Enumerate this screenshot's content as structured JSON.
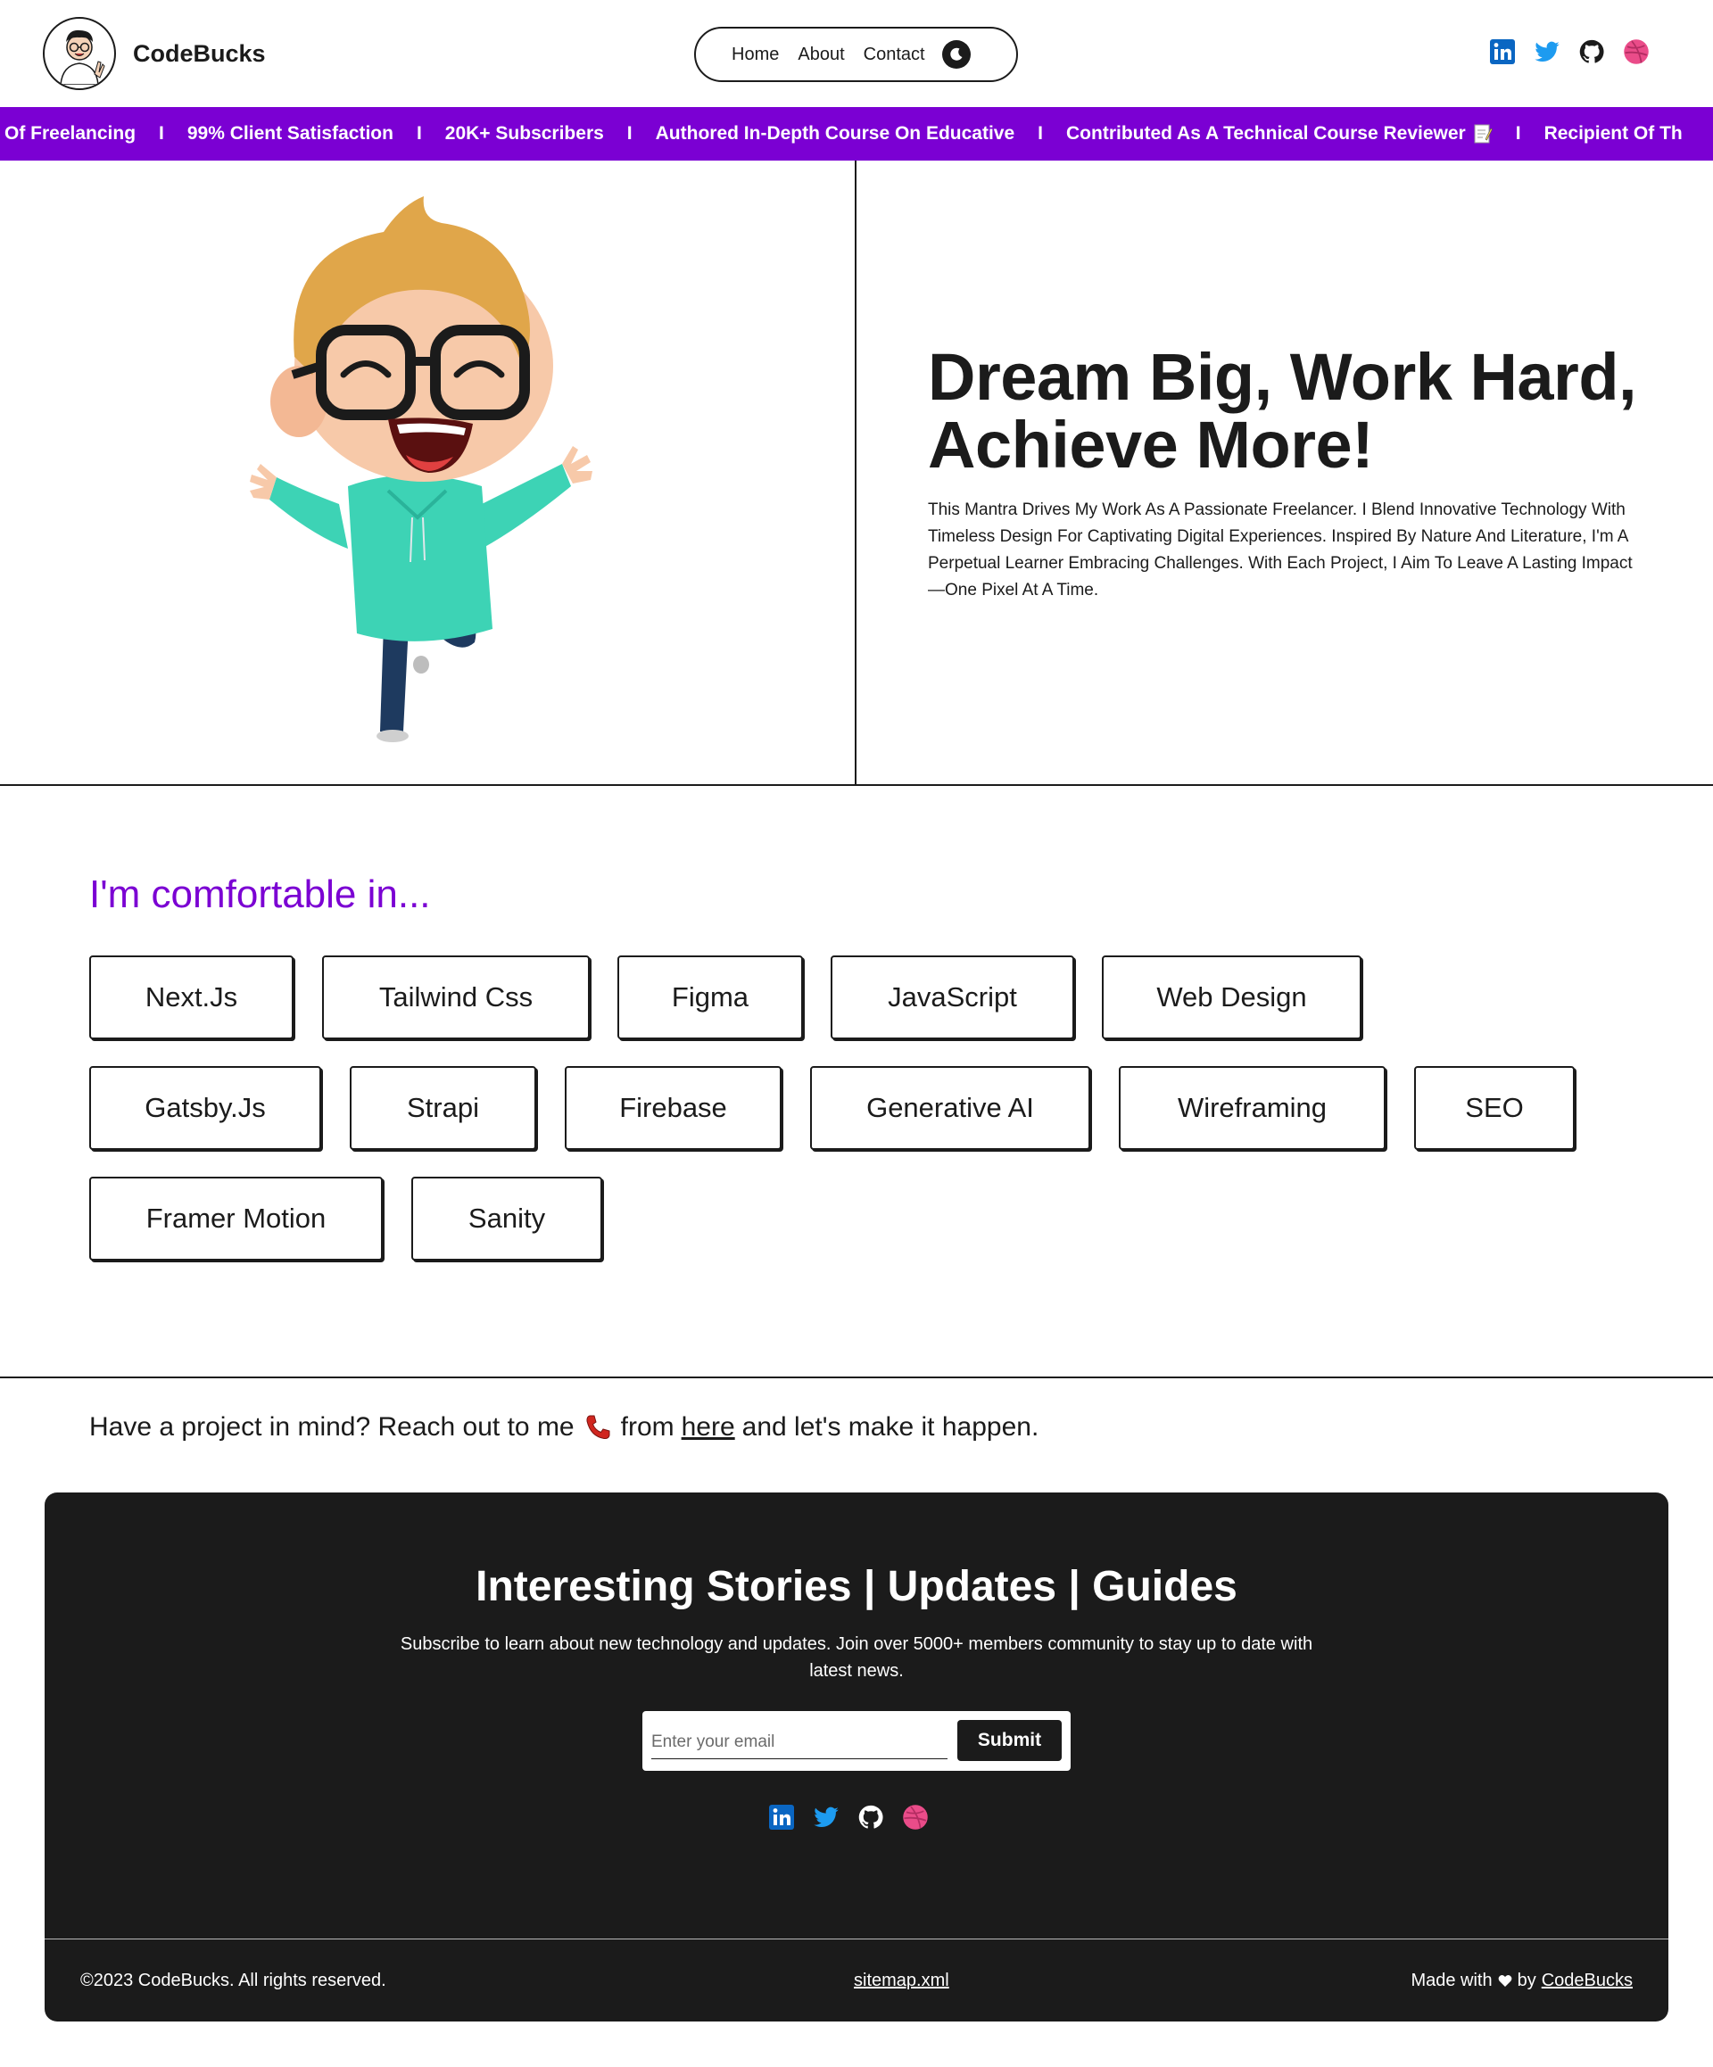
{
  "header": {
    "brand": "CodeBucks",
    "nav": [
      {
        "label": "Home"
      },
      {
        "label": "About"
      },
      {
        "label": "Contact"
      }
    ],
    "mode_toggle_icon": "moon-icon",
    "socials": [
      "linkedin-icon",
      "twitter-icon",
      "github-icon",
      "dribbble-icon"
    ]
  },
  "banner": {
    "items": [
      "Of Freelancing",
      "99% Client Satisfaction",
      "20K+ Subscribers",
      "Authored In-Depth Course On Educative",
      "Contributed As A Technical Course Reviewer",
      "Recipient Of Th"
    ],
    "separator": "I"
  },
  "hero": {
    "title": "Dream Big, Work Hard, Achieve More!",
    "description": "This Mantra Drives My Work As A Passionate Freelancer. I Blend Innovative Technology With Timeless Design For Captivating Digital Experiences. Inspired By Nature And Literature, I'm A Perpetual Learner Embracing Challenges. With Each Project, I Aim To Leave A Lasting Impact—One Pixel At A Time."
  },
  "skills": {
    "title": "I'm comfortable in...",
    "items": [
      "Next.Js",
      "Tailwind Css",
      "Figma",
      "JavaScript",
      "Web Design",
      "Gatsby.Js",
      "Strapi",
      "Firebase",
      "Generative AI",
      "Wireframing",
      "SEO",
      "Framer Motion",
      "Sanity"
    ]
  },
  "cta": {
    "before": "Have a project in mind? Reach out to me",
    "from": "from",
    "link": "here",
    "after": "and let's make it happen."
  },
  "footer": {
    "title": "Interesting Stories | Updates | Guides",
    "description": "Subscribe to learn about new technology and updates. Join over 5000+ members community to stay up to date with latest news.",
    "email_placeholder": "Enter your email",
    "submit_label": "Submit",
    "copyright": "©2023 CodeBucks. All rights reserved.",
    "sitemap": "sitemap.xml",
    "made_with": "Made with",
    "made_by": "by",
    "made_by_link": "CodeBucks"
  },
  "colors": {
    "accent": "#7b00d3",
    "dark": "#1b1b1b",
    "light": "#ffffff",
    "linkedin": "#0a66c2",
    "twitter": "#1d9bf0",
    "dribbble": "#ea4c89"
  }
}
